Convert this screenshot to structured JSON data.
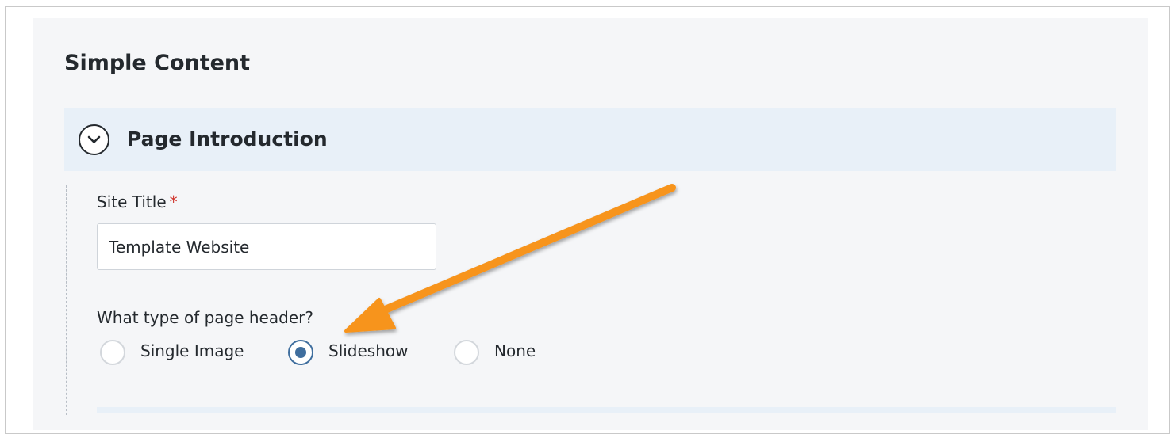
{
  "section": {
    "title": "Simple Content"
  },
  "accordion": {
    "label": "Page Introduction",
    "icon": "chevron-down-icon"
  },
  "site_title": {
    "label": "Site Title",
    "required_marker": "*",
    "value": "Template Website"
  },
  "header_type": {
    "question": "What type of page header?",
    "options": [
      {
        "label": "Single Image",
        "selected": false
      },
      {
        "label": "Slideshow",
        "selected": true
      },
      {
        "label": "None",
        "selected": false
      }
    ]
  },
  "annotation": {
    "icon": "orange-arrow-icon",
    "color": "#f7941d"
  },
  "colors": {
    "accent": "#3f6e9e",
    "accordion_bg": "#e8f0f8",
    "panel_bg": "#f5f6f8",
    "required": "#d0342c"
  }
}
